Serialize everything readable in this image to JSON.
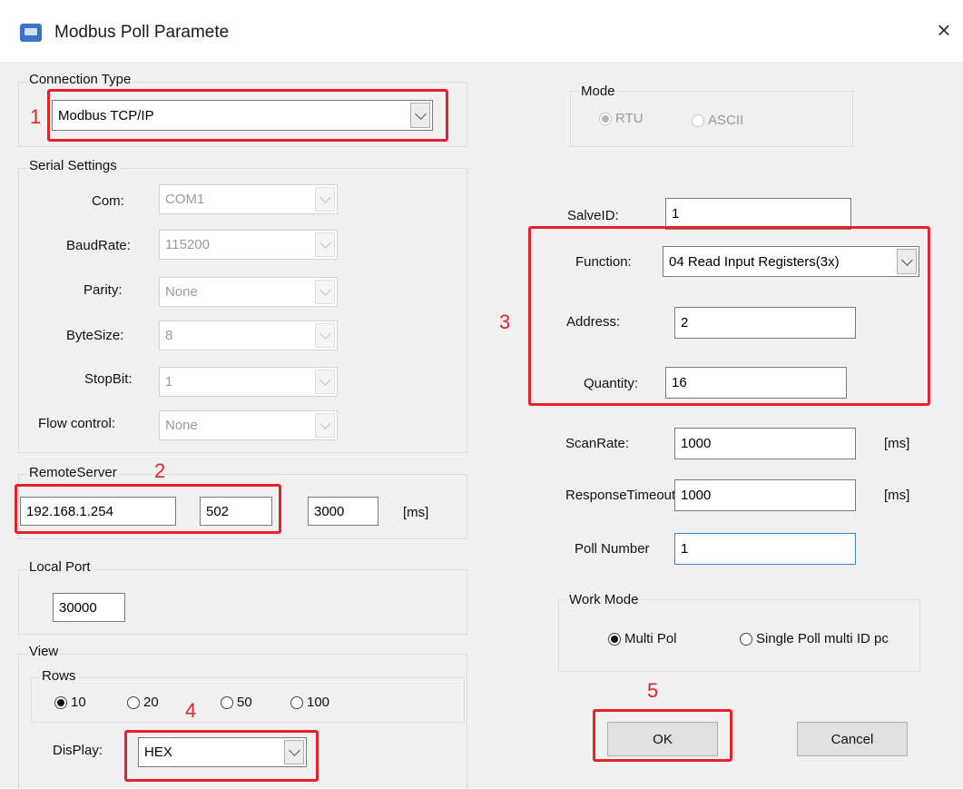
{
  "window": {
    "title": "Modbus Poll Paramete",
    "app_icon": "modbus-app-icon",
    "close_glyph": "×"
  },
  "connection_type": {
    "label": "Connection Type",
    "value": "Modbus TCP/IP"
  },
  "serial_settings": {
    "label": "Serial Settings",
    "com_label": "Com:",
    "com_value": "COM1",
    "baud_label": "BaudRate:",
    "baud_value": "115200",
    "parity_label": "Parity:",
    "parity_value": "None",
    "bytesize_label": "ByteSize:",
    "bytesize_value": "8",
    "stopbit_label": "StopBit:",
    "stopbit_value": "1",
    "flow_label": "Flow control:",
    "flow_value": "None"
  },
  "remote_server": {
    "label": "RemoteServer",
    "ip": "192.168.1.254",
    "port": "502",
    "timeout": "3000",
    "unit": "[ms]"
  },
  "local_port": {
    "label": "Local Port",
    "value": "30000"
  },
  "view": {
    "label": "View",
    "rows_label": "Rows",
    "rows_options": [
      "10",
      "20",
      "50",
      "100"
    ],
    "rows_selected": "10",
    "display_label": "DisPlay:",
    "display_value": "HEX"
  },
  "mode": {
    "label": "Mode",
    "options": [
      "RTU",
      "ASCII"
    ],
    "selected": "RTU"
  },
  "slave_id": {
    "label": "SalveID:",
    "value": "1"
  },
  "function": {
    "label": "Function:",
    "value": "04 Read Input Registers(3x)"
  },
  "address": {
    "label": "Address:",
    "value": "2"
  },
  "quantity": {
    "label": "Quantity:",
    "value": "16"
  },
  "scan_rate": {
    "label": "ScanRate:",
    "value": "1000",
    "unit": "[ms]"
  },
  "response_timeout": {
    "label": "ResponseTimeout",
    "value": "1000",
    "unit": "[ms]"
  },
  "poll_number": {
    "label": "Poll Number",
    "value": "1"
  },
  "work_mode": {
    "label": "Work Mode",
    "options": [
      "Multi Pol",
      "Single Poll multi ID pc"
    ],
    "selected": "Multi Pol"
  },
  "buttons": {
    "ok": "OK",
    "cancel": "Cancel"
  },
  "annotations": [
    "1",
    "2",
    "3",
    "4",
    "5"
  ],
  "colors": {
    "highlight": "#e8202a",
    "dialog_bg": "#f0f0f0",
    "title_bg": "#ffffff"
  }
}
